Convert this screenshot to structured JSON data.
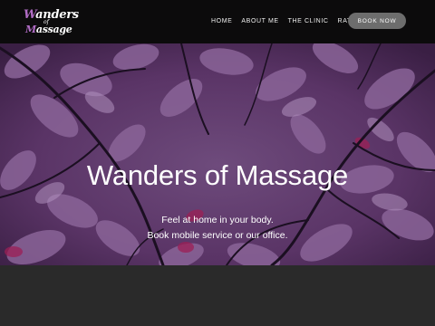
{
  "header": {
    "logo": {
      "line1": "Wanders",
      "of": "of",
      "line2": "Massage"
    },
    "nav": [
      {
        "label": "HOME"
      },
      {
        "label": "ABOUT ME"
      },
      {
        "label": "THE CLINIC"
      },
      {
        "label": "RATES"
      }
    ],
    "cta_label": "BOOK NOW"
  },
  "hero": {
    "title": "Wanders of Massage",
    "line1": "Feel at home in your body.",
    "line2": "Book mobile service or our office.",
    "background_image": "purple-leaves-and-branches"
  },
  "colors": {
    "header_bg": "#0c0b0c",
    "logo_accent": "#b06cc4",
    "button_bg": "#6d6d6d",
    "hero_tint": "#55305f",
    "footer_bg": "#2a2a2a"
  }
}
